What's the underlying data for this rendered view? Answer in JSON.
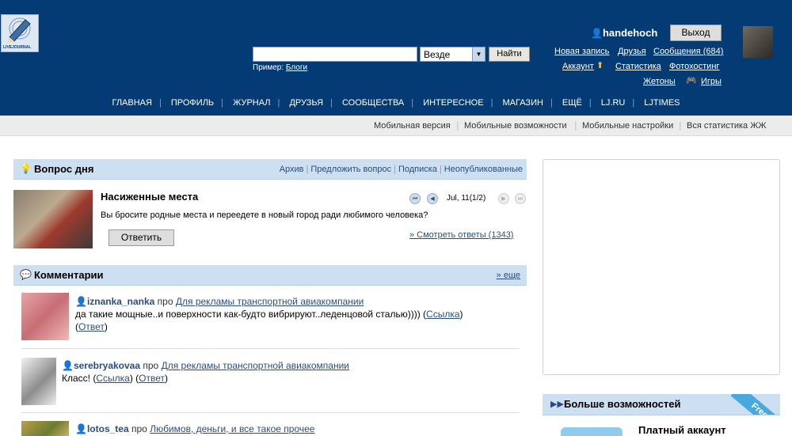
{
  "header": {
    "logo_text": "LIVEJOURNAL",
    "search": {
      "placeholder": "",
      "scope": "Везде",
      "button": "Найти",
      "example_label": "Пример:",
      "example_link": "Блоги"
    },
    "user": {
      "name": "handehoch",
      "logout": "Выход"
    },
    "links": {
      "new_post": "Новая запись",
      "friends": "Друзья",
      "messages": "Сообщения (684)",
      "account": "Аккаунт",
      "stats": "Статистика",
      "photo": "Фотохостинг",
      "tokens": "Жетоны",
      "games": "Игры"
    },
    "nav": [
      "ГЛАВНАЯ",
      "ПРОФИЛЬ",
      "ЖУРНАЛ",
      "ДРУЗЬЯ",
      "СООБЩЕСТВА",
      "ИНТЕРЕСНОЕ",
      "МАГАЗИН",
      "ЕЩЁ",
      "LJ.RU",
      "LJTIMES"
    ]
  },
  "subbar": [
    "Мобильная версия",
    "Мобильные возможности",
    "Мобильные настройки",
    "Вся статистика ЖЖ"
  ],
  "qotd": {
    "title": "Вопрос дня",
    "links": [
      "Архив",
      "Предложить вопрос",
      "Подписка",
      "Неопубликованные"
    ],
    "question_title": "Насиженные места",
    "question_text": "Вы бросите родные места и переедете в новый город ради любимого человека?",
    "answer_button": "Ответить",
    "date": "Jul, 11(1/2)",
    "view_answers": "» Смотреть ответы (1343)"
  },
  "comments": {
    "title": "Комментарии",
    "more": "» еще",
    "items": [
      {
        "user": "iznanka_nanka",
        "pro": "про",
        "post": "Для рекламы транспортной авиакомпании",
        "text": "да такие мощные..и поверхности как-будто вибрируют..леденцовой сталью)))) (",
        "link": "Ссылка",
        "close": ")",
        "reply_open": "(",
        "reply": "Ответ",
        "reply_close": ")"
      },
      {
        "user": "serebryakovaa",
        "pro": "про",
        "post": "Для рекламы транспортной авиакомпании",
        "text": "Класс! (",
        "link": "Ссылка",
        "close": ") (",
        "reply": "Ответ",
        "reply_close": ")"
      },
      {
        "user": "lotos_tea",
        "pro": "про",
        "post": "Любимов, деньги, и все такое прочее"
      }
    ]
  },
  "sidebar": {
    "more_title": "Больше возможностей",
    "badge": "Free",
    "paid_title": "Платный аккаунт"
  },
  "colors": {
    "header_bg": "#053b75",
    "panel_bg": "#cde0f2",
    "link": "#2b4d7d"
  }
}
